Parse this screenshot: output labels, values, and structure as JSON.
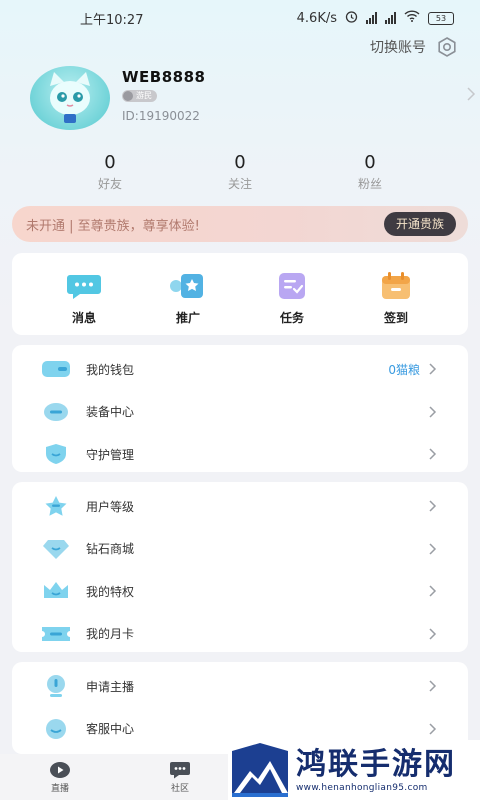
{
  "status_bar": {
    "time": "上午10:27",
    "speed": "4.6K/s",
    "battery": "53"
  },
  "header": {
    "switch_account": "切换账号",
    "icons": [
      "settings-icon"
    ]
  },
  "profile": {
    "username": "WEB8888",
    "level": "游民",
    "user_id": "ID:19190022",
    "avatar_icon": "cat-avatar-icon"
  },
  "stats": [
    {
      "value": "0",
      "label": "好友"
    },
    {
      "value": "0",
      "label": "关注"
    },
    {
      "value": "0",
      "label": "粉丝"
    }
  ],
  "vip_banner": {
    "text": "未开通 | 至尊贵族，尊享体验!",
    "button": "开通贵族"
  },
  "quick_actions": [
    {
      "label": "消息",
      "icon": "message-icon"
    },
    {
      "label": "推广",
      "icon": "promote-icon"
    },
    {
      "label": "任务",
      "icon": "task-icon"
    },
    {
      "label": "签到",
      "icon": "checkin-icon"
    }
  ],
  "menu_group_1": [
    {
      "label": "我的钱包",
      "value": "0猫粮",
      "icon": "wallet-icon"
    },
    {
      "label": "装备中心",
      "value": "",
      "icon": "equipment-icon"
    },
    {
      "label": "守护管理",
      "value": "",
      "icon": "shield-icon"
    }
  ],
  "menu_group_2": [
    {
      "label": "用户等级",
      "icon": "star-icon"
    },
    {
      "label": "钻石商城",
      "icon": "diamond-icon"
    },
    {
      "label": "我的特权",
      "icon": "privilege-icon"
    },
    {
      "label": "我的月卡",
      "icon": "card-icon"
    }
  ],
  "menu_group_3": [
    {
      "label": "申请主播",
      "icon": "anchor-icon"
    },
    {
      "label": "客服中心",
      "icon": "service-icon"
    }
  ],
  "tabbar": [
    {
      "label": "直播",
      "icon": "live-icon"
    },
    {
      "label": "社区",
      "icon": "community-icon"
    }
  ],
  "watermark": {
    "title": "鸿联手游网",
    "url": "www.henanhonglian95.com"
  },
  "colors": {
    "accent": "#3a9be0",
    "vip_button": "#3f3b42",
    "vip_banner": "#f7d6cd",
    "icon_teal": "#52c7e3"
  }
}
